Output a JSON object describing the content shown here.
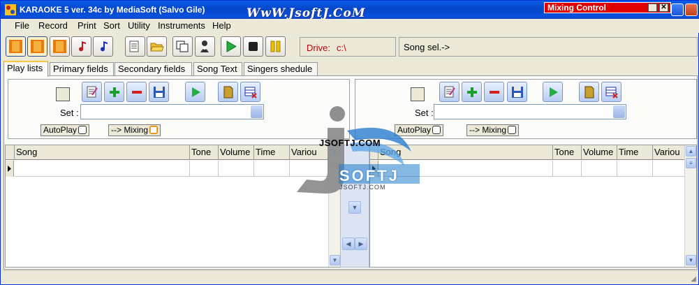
{
  "window": {
    "title": "KARAOKE 5   ver. 34c by MediaSoft (Salvo Gile)",
    "watermark": "WwW.JsoftJ.CoM",
    "mixing_control": "Mixing Control"
  },
  "menu": [
    "File",
    "Record",
    "Print",
    "Sort",
    "Utility",
    "Instruments",
    "Help"
  ],
  "toolbar": {
    "drive_label": "Drive:",
    "drive_value": "c:\\",
    "song_sel": "Song sel.->"
  },
  "tabs": [
    "Play lists",
    "Primary fields",
    "Secondary fields",
    "Song Text",
    "Singers shedule"
  ],
  "left_panel": {
    "set_label": "Set :",
    "autoplay": "AutoPlay",
    "mixing": "--> Mixing"
  },
  "right_panel": {
    "set_label": "Set :",
    "autoplay": "AutoPlay",
    "mixing": "--> Mixing"
  },
  "left_grid": {
    "columns": [
      "Song",
      "Tone",
      "Volume",
      "Time",
      "Variou"
    ]
  },
  "right_grid": {
    "columns": [
      "Song",
      "Tone",
      "Volume",
      "Time",
      "Variou"
    ]
  },
  "logo": {
    "site": "JSOFTJ.COM",
    "brand": "SOFTJ",
    "small": "JSOFTJ.COM"
  },
  "colors": {
    "title_bar": "#0a5ee8",
    "mixing_bar": "#e00000",
    "drive_text": "#c00000"
  }
}
